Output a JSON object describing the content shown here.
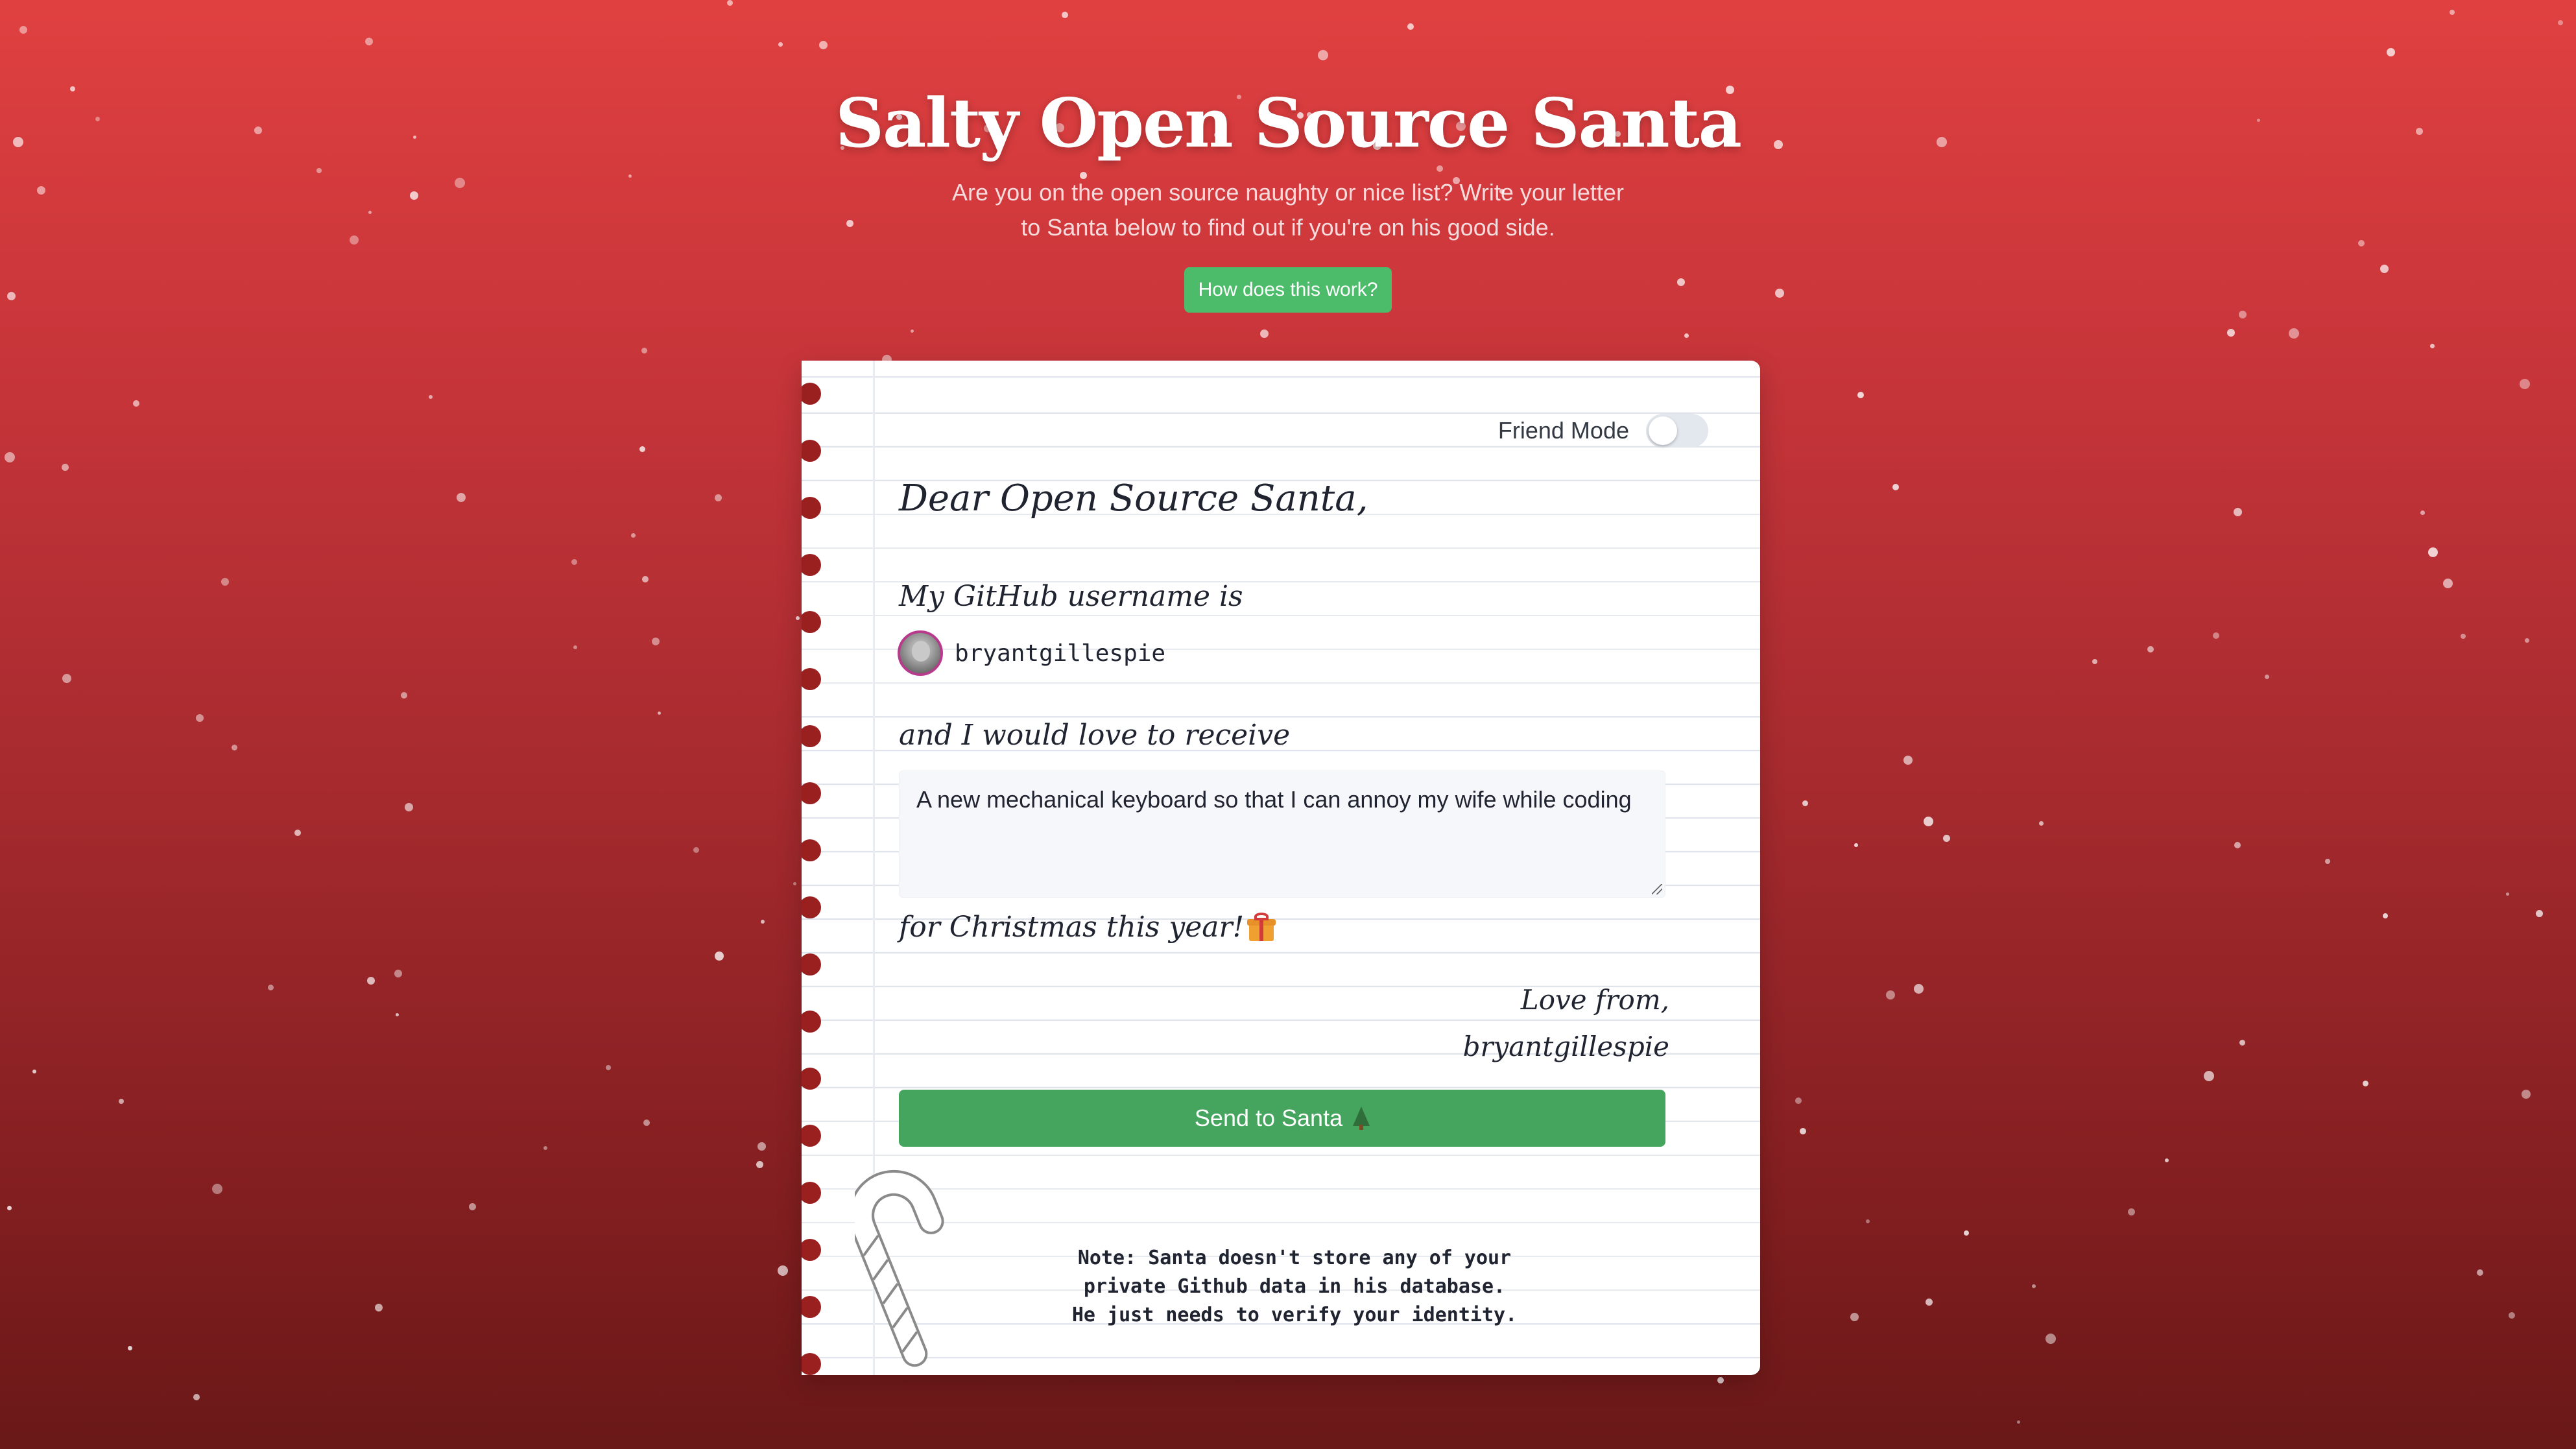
{
  "header": {
    "title": "Salty Open Source Santa",
    "subtitle": "Are you on the open source naughty or nice list? Write your letter to Santa below to find out if you're on his good side.",
    "how_button": "How does this work?"
  },
  "letter": {
    "friend_mode_label": "Friend Mode",
    "friend_mode_on": false,
    "greeting": "Dear Open Source Santa,",
    "username_label": "My GitHub username is",
    "username": "bryantgillespie",
    "receive_label": "and I would love to receive",
    "wish_text": "A new mechanical keyboard so that I can annoy my wife while coding",
    "christmas_label": "for Christmas this year!",
    "signoff_line": "Love from,",
    "signoff_name": "bryantgillespie",
    "send_button": "Send to Santa",
    "note_lines": [
      "Note: Santa doesn't store any of your",
      "private Github data in his database.",
      "He just needs to verify your identity."
    ]
  },
  "icons": {
    "gift": "gift-icon",
    "tree": "christmas-tree-icon",
    "candy_cane": "candy-cane-icon",
    "avatar": "avatar"
  },
  "colors": {
    "background_top": "#e04040",
    "background_bottom": "#6a1818",
    "button_green": "#45a55e",
    "how_button_green": "#4cbc6b",
    "binder_hole": "#9a1f1f"
  }
}
